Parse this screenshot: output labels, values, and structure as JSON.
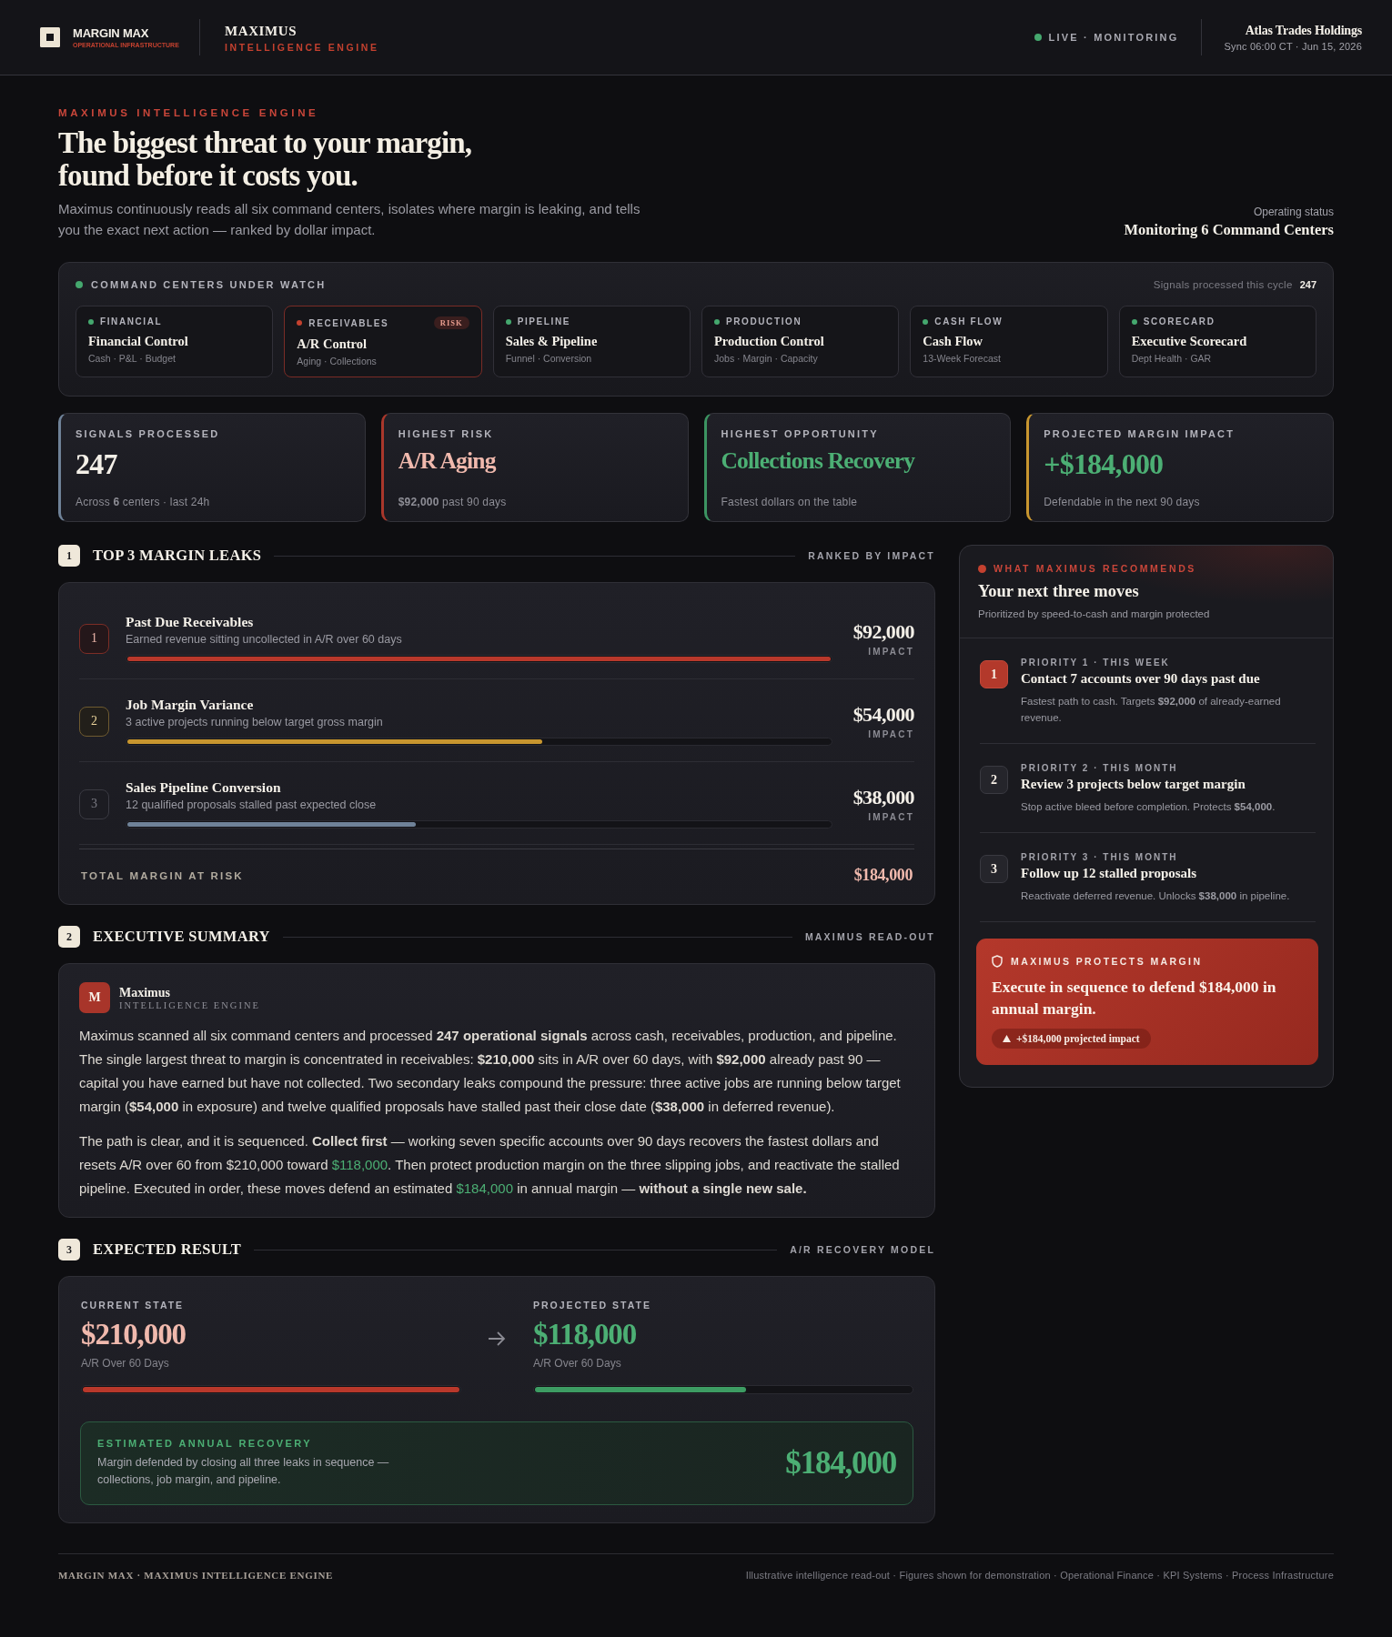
{
  "header": {
    "brand": {
      "name": "MARGIN MAX",
      "tagline": "OPERATIONAL INFRASTRUCTURE"
    },
    "product": {
      "name": "MAXIMUS",
      "subtitle": "INTELLIGENCE ENGINE"
    },
    "live": {
      "label": "LIVE · MONITORING",
      "on": true
    },
    "account": {
      "name": "Atlas Trades Holdings",
      "sync": "Sync 06:00 CT · Jun 15, 2026"
    }
  },
  "hero": {
    "eyebrow": "MAXIMUS INTELLIGENCE ENGINE",
    "title_lines": [
      "The biggest threat to your margin,",
      "found before it costs you."
    ],
    "description": "Maximus continuously reads all six command centers, isolates where margin is leaking, and tells you the exact next action — ranked by dollar impact.",
    "status_label": "Operating status",
    "status_value": "Monitoring 6 Command Centers"
  },
  "command_centers": {
    "title": "COMMAND CENTERS UNDER WATCH",
    "live": true,
    "signals_label": "Signals processed this cycle",
    "signals_count": "247",
    "centers": [
      {
        "category": "FINANCIAL",
        "name": "Financial Control",
        "detail": "Cash · P&L · Budget",
        "at_risk": false
      },
      {
        "category": "RECEIVABLES",
        "name": "A/R Control",
        "detail": "Aging · Collections",
        "at_risk": true,
        "badge": "RISK"
      },
      {
        "category": "PIPELINE",
        "name": "Sales & Pipeline",
        "detail": "Funnel · Conversion",
        "at_risk": false
      },
      {
        "category": "PRODUCTION",
        "name": "Production Control",
        "detail": "Jobs · Margin · Capacity",
        "at_risk": false
      },
      {
        "category": "CASH FLOW",
        "name": "Cash Flow",
        "detail": "13-Week Forecast",
        "at_risk": false
      },
      {
        "category": "SCORECARD",
        "name": "Executive Scorecard",
        "detail": "Dept Health · GAR",
        "at_risk": false
      }
    ]
  },
  "kpis": [
    {
      "label": "SIGNALS PROCESSED",
      "value": "247",
      "note": "Across **6** centers · last 24h",
      "kind": "metric"
    },
    {
      "label": "HIGHEST RISK",
      "value": "A/R Aging",
      "note": "**$92,000** past 90 days",
      "kind": "risk"
    },
    {
      "label": "HIGHEST OPPORTUNITY",
      "value": "Collections Recovery",
      "note": "Fastest dollars on the table",
      "kind": "opportunity"
    },
    {
      "label": "PROJECTED MARGIN IMPACT",
      "value": "+$184,000",
      "note": "Defendable in the next 90 days",
      "kind": "impact"
    }
  ],
  "leaks": {
    "index": "1",
    "title": "TOP 3 MARGIN LEAKS",
    "tag": "RANKED BY IMPACT",
    "items": [
      {
        "rank": "1",
        "title": "Past Due Receivables",
        "description": "Earned revenue sitting uncollected in A/R over 60 days",
        "amount": "$92,000",
        "amount_label": "IMPACT",
        "level": 1,
        "kind": "critical"
      },
      {
        "rank": "2",
        "title": "Job Margin Variance",
        "description": "3 active projects running below target gross margin",
        "amount": "$54,000",
        "amount_label": "IMPACT",
        "level": 0.59,
        "kind": "warning"
      },
      {
        "rank": "3",
        "title": "Sales Pipeline Conversion",
        "description": "12 qualified proposals stalled past expected close",
        "amount": "$38,000",
        "amount_label": "IMPACT",
        "level": 0.41,
        "kind": "minor"
      }
    ],
    "total": {
      "label": "TOTAL MARGIN AT RISK",
      "value": "$184,000"
    }
  },
  "recommendations": {
    "eyebrow": "WHAT MAXIMUS RECOMMENDS",
    "title": "Your next three moves",
    "subtitle": "Prioritized by speed-to-cash and margin protected",
    "moves": [
      {
        "rank": "1",
        "meta": "PRIORITY 1 · THIS WEEK",
        "title": "Contact 7 accounts over 90 days past due",
        "description": "Fastest path to cash. Targets **$92,000** of already-earned revenue.",
        "urgent": true
      },
      {
        "rank": "2",
        "meta": "PRIORITY 2 · THIS MONTH",
        "title": "Review 3 projects below target margin",
        "description": "Stop active bleed before completion. Protects **$54,000**.",
        "urgent": false
      },
      {
        "rank": "3",
        "meta": "PRIORITY 3 · THIS MONTH",
        "title": "Follow up 12 stalled proposals",
        "description": "Reactivate deferred revenue. Unlocks **$38,000** in pipeline.",
        "urgent": false
      }
    ],
    "callout": {
      "eyebrow": "MAXIMUS PROTECTS MARGIN",
      "message": "Execute in sequence to defend $184,000 in annual margin.",
      "badge": "+$184,000 projected impact"
    }
  },
  "summary": {
    "index": "2",
    "title": "EXECUTIVE SUMMARY",
    "tag": "MAXIMUS READ-OUT",
    "author": {
      "initial": "M",
      "name": "Maximus",
      "role": "INTELLIGENCE ENGINE"
    },
    "paragraphs": [
      [
        {
          "text": "Maximus scanned all six command centers and processed **247 operational signals** across cash, receivables, production, and pipeline. The single largest threat to margin is concentrated in receivables: **$210,000** sits in A/R over 60 days, with **$92,000** already past 90 — capital you have earned but have not collected. Two secondary leaks compound the pressure: three active jobs are running below target margin (**$54,000** in exposure) and twelve qualified proposals have stalled past their close date (**$38,000** in deferred revenue).",
          "highlight": false
        }
      ],
      [
        {
          "text": "The path is clear, and it is sequenced. **Collect first** — working seven specific accounts over 90 days recovers the fastest dollars and resets A/R over 60 from $210,000 toward ",
          "highlight": false
        },
        {
          "text": "$118,000",
          "highlight": true
        },
        {
          "text": ". Then protect production margin on the three slipping jobs, and reactivate the stalled pipeline. Executed in order, these moves defend an estimated ",
          "highlight": false
        },
        {
          "text": "$184,000",
          "highlight": true
        },
        {
          "text": " in annual margin — **without a single new sale.**",
          "highlight": false
        }
      ]
    ]
  },
  "result": {
    "index": "3",
    "title": "EXPECTED RESULT",
    "tag": "A/R RECOVERY MODEL",
    "states": [
      {
        "label": "CURRENT STATE",
        "value": "$210,000",
        "caption": "A/R Over 60 Days",
        "level": 1,
        "kind": "current"
      },
      {
        "label": "PROJECTED STATE",
        "value": "$118,000",
        "caption": "A/R Over 60 Days",
        "level": 0.56,
        "kind": "projected"
      }
    ],
    "recovery": {
      "label": "ESTIMATED ANNUAL RECOVERY",
      "description": "Margin defended by closing all three leaks in sequence — collections, job margin, and pipeline.",
      "value": "$184,000"
    }
  },
  "footer": {
    "brand": "MARGIN MAX · MAXIMUS INTELLIGENCE ENGINE",
    "note": "Illustrative intelligence read-out · Figures shown for demonstration · Operational Finance · KPI Systems · Process Infrastructure"
  }
}
